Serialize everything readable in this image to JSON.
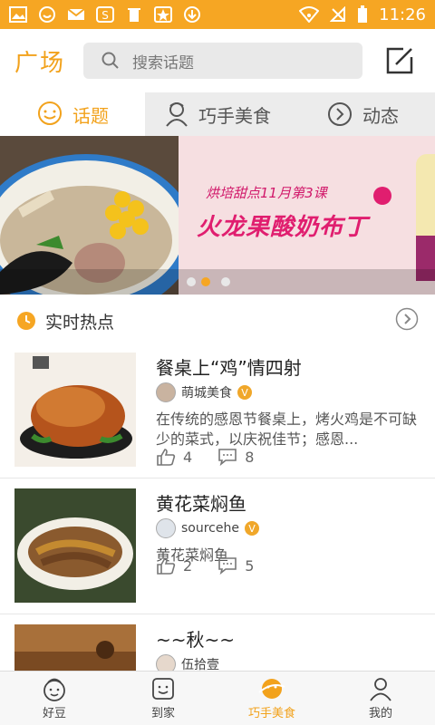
{
  "status_bar": {
    "time": "11:26",
    "left_icons": [
      "image-icon",
      "emoji-icon",
      "mail-icon",
      "s-app-icon",
      "trash-icon",
      "star-badge-icon",
      "download-icon"
    ],
    "right_icons": [
      "wifi-icon",
      "no-signal-icon",
      "battery-icon"
    ]
  },
  "header": {
    "title": "广场",
    "search_placeholder": "搜索话题"
  },
  "tabs": [
    {
      "label": "话题",
      "icon": "chat-icon",
      "active": true
    },
    {
      "label": "巧手美食",
      "icon": "chef-icon",
      "active": false
    },
    {
      "label": "动态",
      "icon": "compass-icon",
      "active": false
    }
  ],
  "banner": {
    "subtitle": "烘培甜点11月第3课",
    "main_text": "火龙果酸奶布丁",
    "slides": 3,
    "active_slide": 2
  },
  "hot_section": {
    "title": "实时热点"
  },
  "posts": [
    {
      "title": "餐桌上“鸡”情四射",
      "author": "萌城美食",
      "verified": true,
      "description": "在传统的感恩节餐桌上，烤火鸡是不可缺少的菜式，以庆祝佳节；感恩...",
      "likes": "4",
      "comments": "8"
    },
    {
      "title": "黄花菜焖鱼",
      "author": "sourcehe",
      "verified": true,
      "description": "黄花菜焖鱼",
      "likes": "2",
      "comments": "5"
    },
    {
      "title": "~~秋~~",
      "author": "伍拾壹",
      "verified": false,
      "description": "",
      "likes": "",
      "comments": ""
    }
  ],
  "bottom_nav": [
    {
      "label": "好豆",
      "icon": "chef-hat-icon",
      "active": false
    },
    {
      "label": "到家",
      "icon": "smile-box-icon",
      "active": false
    },
    {
      "label": "巧手美食",
      "icon": "planet-icon",
      "active": true
    },
    {
      "label": "我的",
      "icon": "person-icon",
      "active": false
    }
  ],
  "colors": {
    "accent": "#f6a623",
    "brand_text": "#f2a21c",
    "banner_pink": "#e01e6f"
  }
}
